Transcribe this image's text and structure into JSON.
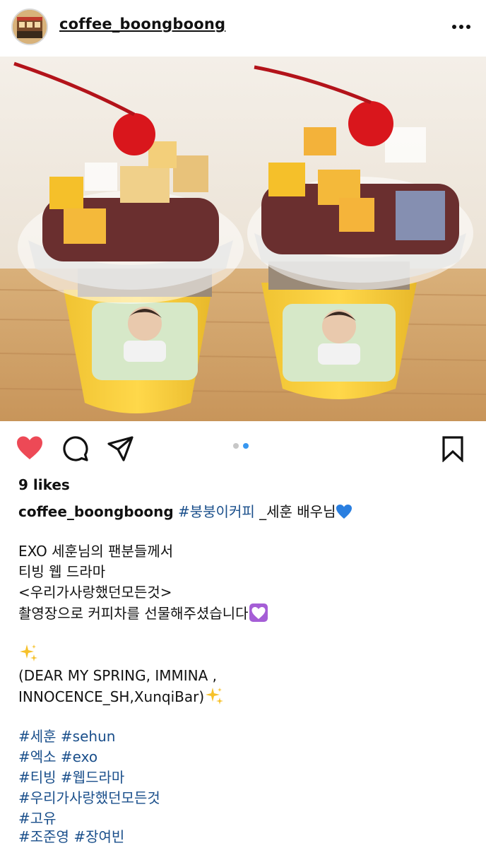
{
  "post": {
    "username": "coffee_boongboong",
    "likes": "9 likes",
    "caption_user": "coffee_boongboong",
    "caption_tag": "#붕붕이커피",
    "caption_rest": " _세훈 배우님",
    "lines": [
      "EXO 세훈님의 팬분들께서",
      "티빙 웹 드라마",
      "<우리가사랑했던모든것>",
      "촬영장으로  커피차를 선물해주셨습니다"
    ],
    "thanks_line1": "(DEAR MY SPRING, IMMINA ,",
    "thanks_line2": "INNOCENCE_SH,XunqiBar)",
    "hashtag_lines": [
      "#세훈 #sehun",
      "#엑소 #exo",
      "#티빙 #웹드라마",
      "#우리가사랑했던모든것",
      "#고유",
      "#조준영 #장여빈"
    ]
  },
  "carousel": {
    "current": 2,
    "total": 2
  },
  "colors": {
    "like_red": "#ed4956",
    "link_blue": "#1a4f8b",
    "dot_active": "#3897f0"
  },
  "icons": [
    "more-icon",
    "heart-icon",
    "comment-icon",
    "share-icon",
    "bookmark-icon"
  ]
}
